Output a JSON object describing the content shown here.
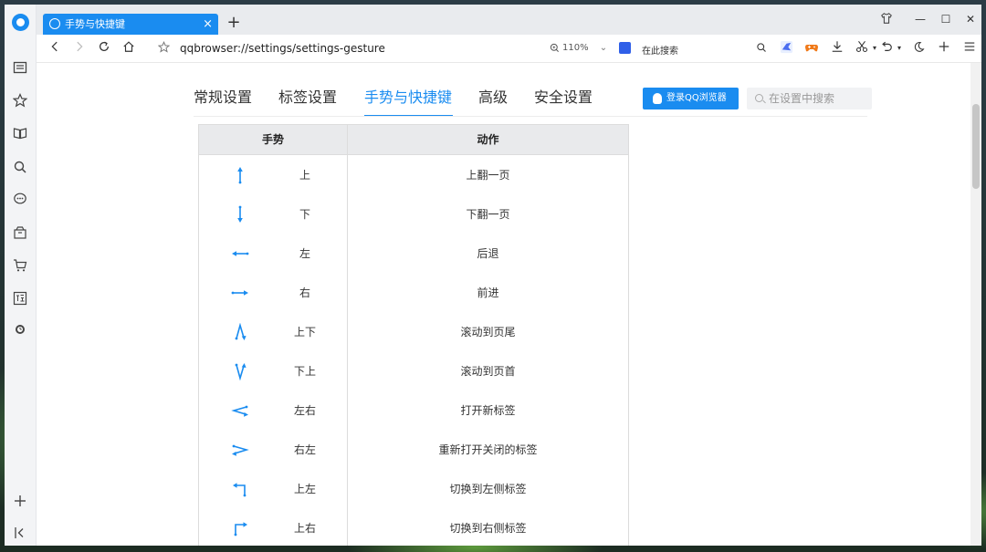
{
  "colors": {
    "accent": "#1a8cf0"
  },
  "tab": {
    "title": "手势与快捷键",
    "close": "×",
    "new_tab": "+"
  },
  "window_controls": {
    "skin": "skin-icon",
    "minimize": "—",
    "maximize": "☐",
    "close": "✕"
  },
  "address_bar": {
    "url": "qqbrowser://settings/settings-gesture",
    "zoom": "110%",
    "search_placeholder": "在此搜索"
  },
  "settings_nav": {
    "items": [
      {
        "label": "常规设置"
      },
      {
        "label": "标签设置"
      },
      {
        "label": "手势与快捷键",
        "active": true
      },
      {
        "label": "高级"
      },
      {
        "label": "安全设置"
      }
    ],
    "login_button": "登录QQ浏览器",
    "search_placeholder": "在设置中搜索"
  },
  "gesture_table": {
    "headers": {
      "gesture": "手势",
      "action": "动作"
    },
    "rows": [
      {
        "icon": "arrow-up-icon",
        "gesture": "上",
        "action": "上翻一页"
      },
      {
        "icon": "arrow-down-icon",
        "gesture": "下",
        "action": "下翻一页"
      },
      {
        "icon": "arrow-left-icon",
        "gesture": "左",
        "action": "后退"
      },
      {
        "icon": "arrow-right-icon",
        "gesture": "右",
        "action": "前进"
      },
      {
        "icon": "up-down-icon",
        "gesture": "上下",
        "action": "滚动到页尾"
      },
      {
        "icon": "down-up-icon",
        "gesture": "下上",
        "action": "滚动到页首"
      },
      {
        "icon": "left-right-icon",
        "gesture": "左右",
        "action": "打开新标签"
      },
      {
        "icon": "right-left-icon",
        "gesture": "右左",
        "action": "重新打开关闭的标签"
      },
      {
        "icon": "up-left-icon",
        "gesture": "上左",
        "action": "切换到左侧标签"
      },
      {
        "icon": "up-right-icon",
        "gesture": "上右",
        "action": "切换到右侧标签"
      }
    ]
  }
}
